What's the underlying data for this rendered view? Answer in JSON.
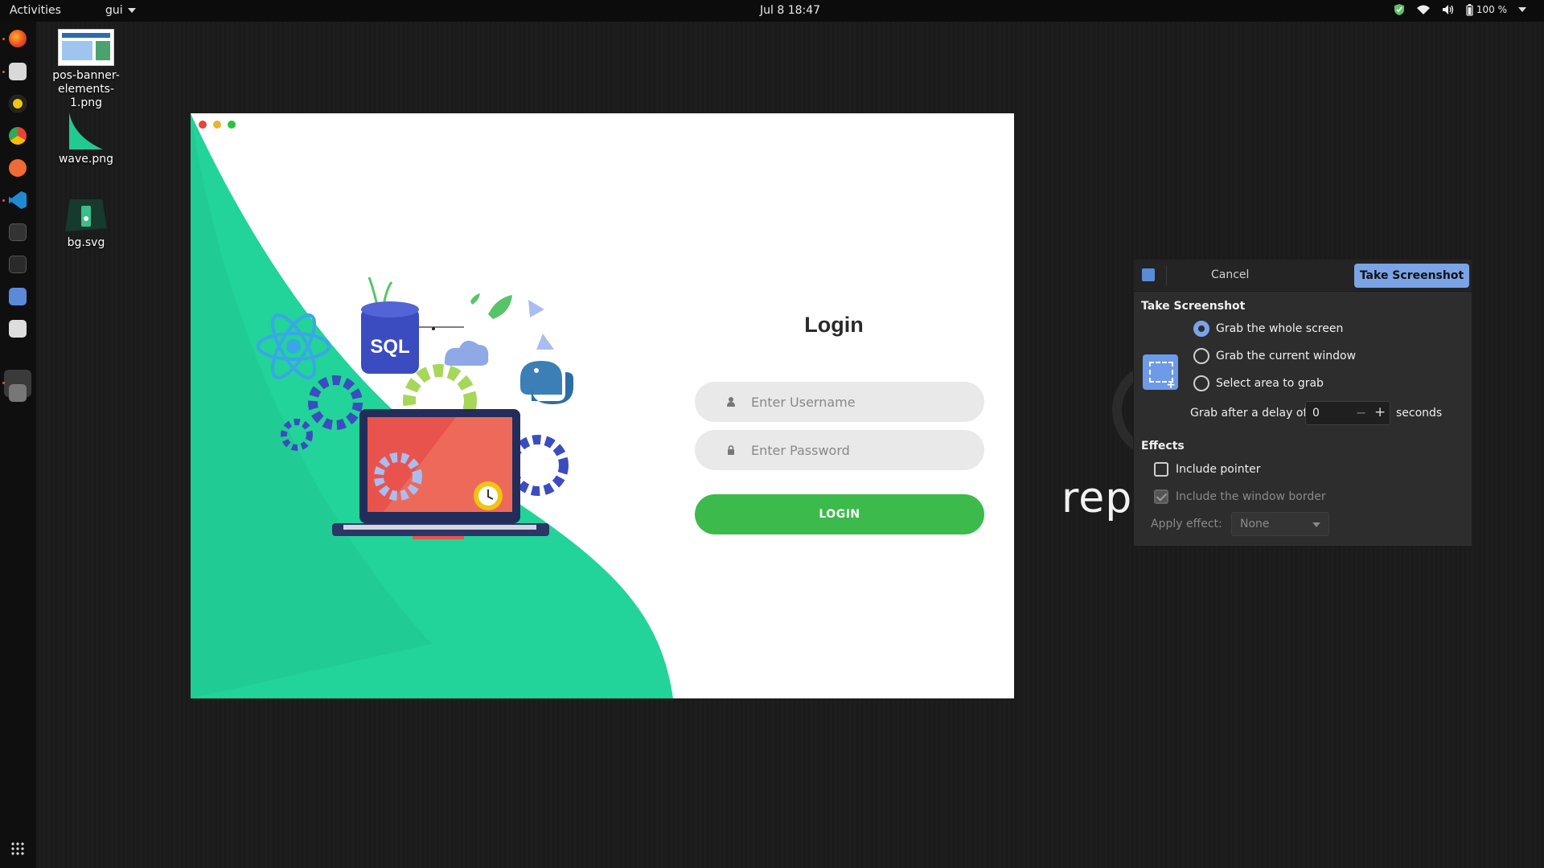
{
  "topbar": {
    "activities": "Activities",
    "app_menu": "gui",
    "clock": "Jul 8  18:47",
    "battery": "100 %"
  },
  "desktop": {
    "icons": [
      {
        "label": "pos-banner-\nelements-1.png",
        "icon": "image-thumbnail-icon"
      },
      {
        "label": "wave.png",
        "icon": "wave-image-icon"
      },
      {
        "label": "bg.svg",
        "icon": "svg-image-icon"
      }
    ]
  },
  "login_window": {
    "title": "Login",
    "username_placeholder": "Enter Username",
    "password_placeholder": "Enter Password",
    "login_button": "LOGIN",
    "illustration_text": "SQL",
    "accent_color": "#3cba4c",
    "wave_color": "#22d39a"
  },
  "background_text": "repo",
  "screenshot_dialog": {
    "cancel": "Cancel",
    "take_screenshot_button": "Take Screenshot",
    "section_title": "Take Screenshot",
    "options": [
      {
        "label": "Grab the whole screen",
        "selected": true
      },
      {
        "label": "Grab the current window",
        "selected": false
      },
      {
        "label": "Select area to grab",
        "selected": false
      }
    ],
    "delay_label": "Grab after a delay of",
    "delay_value": "0",
    "delay_unit": "seconds",
    "effects_title": "Effects",
    "include_pointer": "Include pointer",
    "include_border": "Include the window border",
    "apply_effect_label": "Apply effect:",
    "apply_effect_value": "None",
    "accent_color": "#7ba4e6"
  }
}
